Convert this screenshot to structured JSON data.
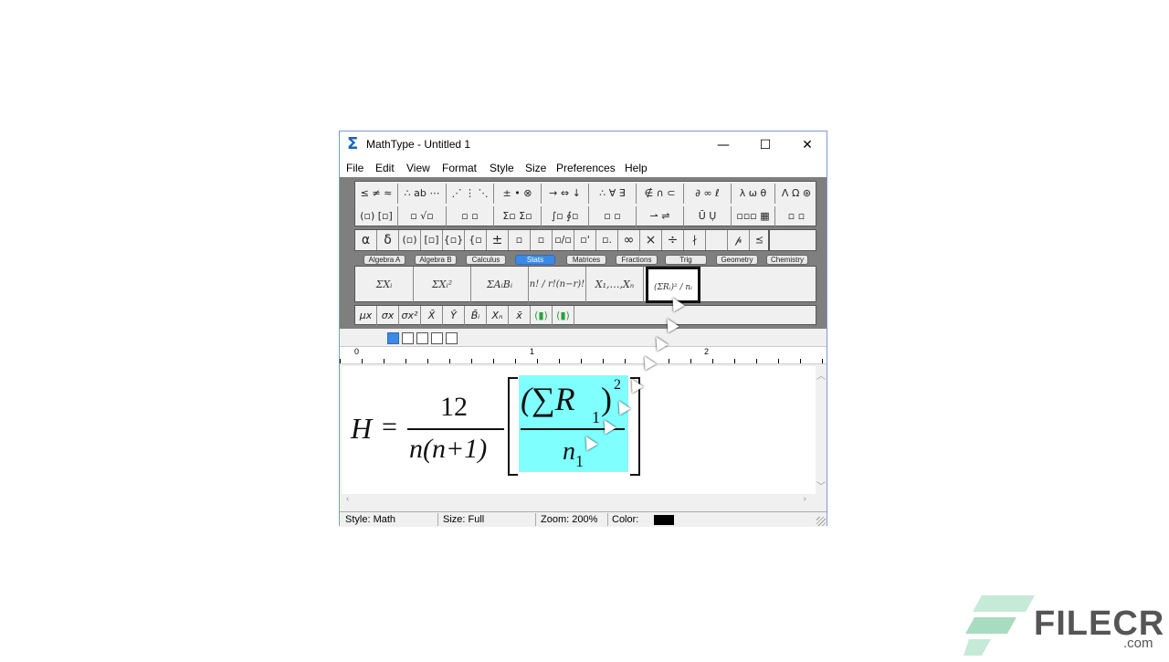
{
  "window": {
    "title": "MathType - Untitled 1",
    "controls": {
      "minimize": "—",
      "maximize": "☐",
      "close": "✕"
    }
  },
  "menu": [
    "File",
    "Edit",
    "View",
    "Format",
    "Style",
    "Size",
    "Preferences",
    "Help"
  ],
  "symbol_row1": [
    "≤ ≠ ≈",
    "∴ ab ⋯",
    "⋰ ⋮ ⋱",
    "± • ⊗",
    "→ ⇔ ↓",
    "∴ ∀ ∃",
    "∉ ∩ ⊂",
    "∂ ∞ ℓ",
    "λ ω θ",
    "Λ Ω ⊛"
  ],
  "symbol_row2": [
    "(▫) [▫]",
    "▫ √▫",
    "▫ ▫",
    "Σ▫ Σ▫",
    "∫▫ ∮▫",
    "▫ ▫",
    "⇀ ⇌",
    "Ū Ụ",
    "▫▫▫ ▦",
    "▫ ▫"
  ],
  "small_symbols": [
    "α",
    "δ",
    "(▫)",
    "[▫]",
    "{▫}",
    "{▫",
    "±",
    "▫",
    "▫",
    "▫/▫",
    "▫'",
    "▫.",
    "∞",
    "×",
    "÷",
    "∤",
    "",
    "𝓅",
    "⪯"
  ],
  "tabs": [
    "Algebra A",
    "Algebra B",
    "Calculus",
    "Stats",
    "Matrices",
    "Fractions",
    "Trig",
    "Geometry",
    "Chemistry"
  ],
  "active_tab": "Stats",
  "templates": [
    "ΣXᵢ",
    "ΣXᵢ²",
    "ΣAᵢBᵢ",
    "n! / r!(n−r)!",
    "X₁,…,Xₙ",
    "(ΣRᵢ)² / nᵢ"
  ],
  "stat_symbols": [
    "μx",
    "σx",
    "σx²",
    "X̄",
    "Ȳ",
    "B̄ᵢ",
    "Xₙ",
    "x̄",
    "(▮)",
    "(▮)"
  ],
  "ruler_marks": [
    "0",
    "1",
    "2"
  ],
  "equation": {
    "lhs": "H",
    "eq": "=",
    "numerator": "12",
    "denominator": "n(n+1)",
    "sum_term": "(∑R",
    "sub1": "1",
    "close": ")",
    "power": "2",
    "n_den": "n",
    "sub2": "1"
  },
  "status": {
    "style": "Style: Math",
    "size": "Size: Full",
    "zoom": "Zoom: 200%",
    "color": "Color:"
  },
  "watermark": {
    "brand": "FILECR",
    "domain": ".com"
  },
  "colors": {
    "accent": "#3c8ae6",
    "selection": "#80ffff",
    "logo": "#2e7d5b",
    "logo_text": "#555555"
  }
}
